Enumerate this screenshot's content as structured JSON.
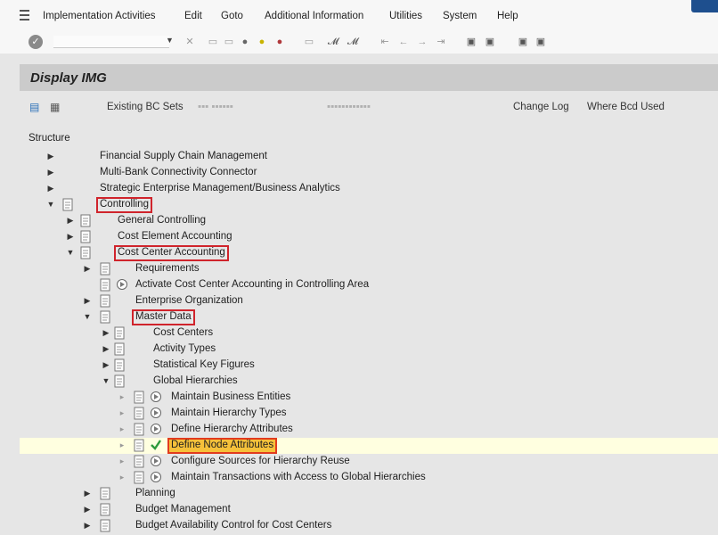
{
  "menubar": {
    "items": [
      "Implementation Activities",
      "Edit",
      "Goto",
      "Additional Information",
      "Utilities",
      "System",
      "Help"
    ]
  },
  "toolbar": {
    "icons": [
      "enter-icon",
      "save-icon",
      "back-icon",
      "exit-icon",
      "cancel-icon",
      "print-icon",
      "find-icon",
      "find-next-icon",
      "first-page-icon",
      "prev-page-icon",
      "next-page-icon",
      "last-page-icon",
      "new-session-icon",
      "shortcut-icon",
      "help-icon",
      "settings-icon"
    ]
  },
  "title": "Display IMG",
  "app_toolbar": {
    "existing_bc_sets": "Existing BC Sets",
    "change_log": "Change Log",
    "where_bc_set_used": "Where Bcd Used"
  },
  "tree": {
    "header": "Structure",
    "rows": [
      {
        "label": "Financial Supply Chain Management",
        "level": 0,
        "expand": "collapsed"
      },
      {
        "label": "Multi-Bank Connectivity Connector",
        "level": 0,
        "expand": "collapsed"
      },
      {
        "label": "Strategic Enterprise Management/Business Analytics",
        "level": 0,
        "expand": "collapsed"
      },
      {
        "label": "Controlling",
        "level": 0,
        "expand": "expanded",
        "highlight": "red"
      },
      {
        "label": "General Controlling",
        "level": 1,
        "expand": "collapsed"
      },
      {
        "label": "Cost Element Accounting",
        "level": 1,
        "expand": "collapsed"
      },
      {
        "label": "Cost Center Accounting",
        "level": 1,
        "expand": "expanded",
        "highlight": "red"
      },
      {
        "label": "Requirements",
        "level": 2,
        "expand": "collapsed"
      },
      {
        "label": "Activate Cost Center Accounting in Controlling Area",
        "level": 2,
        "expand": "none"
      },
      {
        "label": "Enterprise Organization",
        "level": 2,
        "expand": "collapsed"
      },
      {
        "label": "Master Data",
        "level": 2,
        "expand": "expanded",
        "highlight": "red"
      },
      {
        "label": "Cost Centers",
        "level": 3,
        "expand": "collapsed"
      },
      {
        "label": "Activity Types",
        "level": 3,
        "expand": "collapsed"
      },
      {
        "label": "Statistical Key Figures",
        "level": 3,
        "expand": "collapsed"
      },
      {
        "label": "Global Hierarchies",
        "level": 3,
        "expand": "expanded"
      },
      {
        "label": "Maintain Business Entities",
        "level": 4,
        "expand": "none"
      },
      {
        "label": "Maintain Hierarchy Types",
        "level": 4,
        "expand": "none"
      },
      {
        "label": "Define Hierarchy Attributes",
        "level": 4,
        "expand": "none"
      },
      {
        "label": "Define Node Attributes",
        "level": 4,
        "expand": "none",
        "highlight": "orange",
        "selected": true
      },
      {
        "label": "Configure Sources for Hierarchy Reuse",
        "level": 4,
        "expand": "none"
      },
      {
        "label": "Maintain Transactions with Access to Global Hierarchies",
        "level": 4,
        "expand": "none"
      },
      {
        "label": "Planning",
        "level": 2,
        "expand": "collapsed"
      },
      {
        "label": "Budget Management",
        "level": 2,
        "expand": "collapsed"
      },
      {
        "label": "Budget Availability Control for Cost Centers",
        "level": 2,
        "expand": "collapsed"
      }
    ]
  }
}
